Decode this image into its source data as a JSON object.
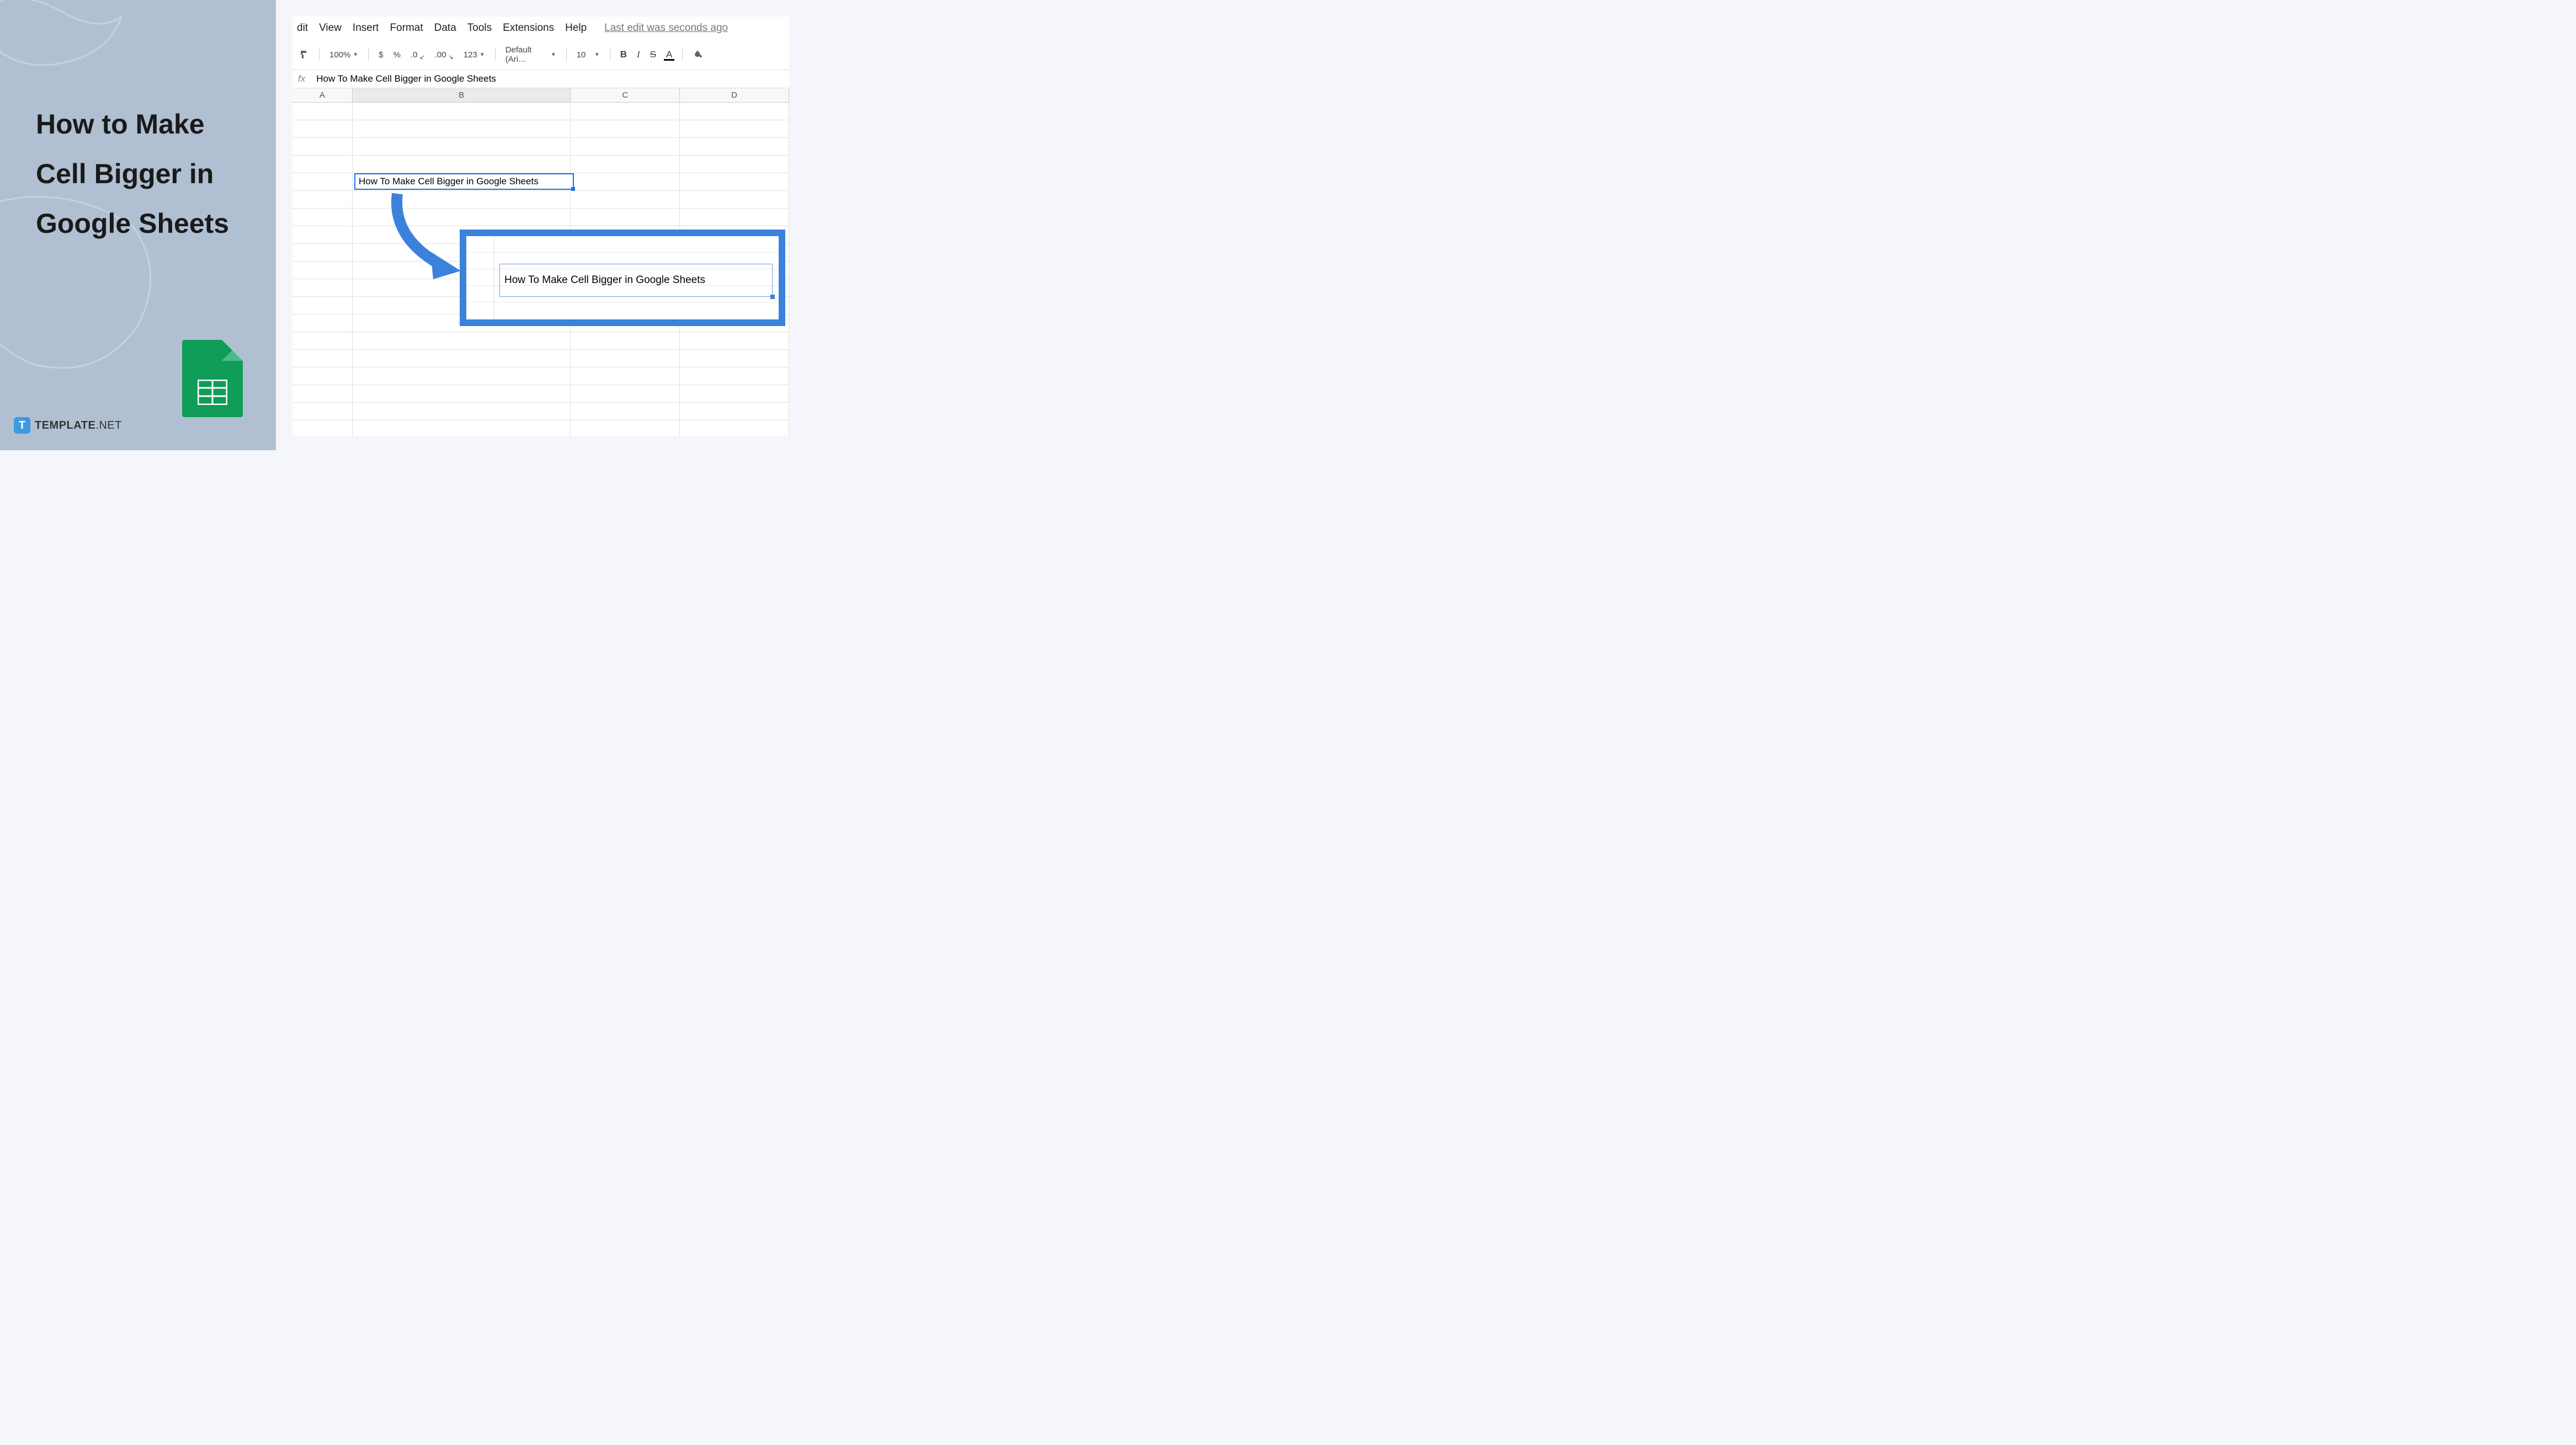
{
  "left": {
    "title": "How to Make\nCell Bigger in\nGoogle Sheets",
    "logo_t": "T",
    "logo_name": "TEMPLATE",
    "logo_tld": ".NET"
  },
  "menu": {
    "edit": "dit",
    "view": "View",
    "insert": "Insert",
    "format": "Format",
    "data": "Data",
    "tools": "Tools",
    "extensions": "Extensions",
    "help": "Help",
    "last_edit": "Last edit was seconds ago"
  },
  "toolbar": {
    "zoom": "100%",
    "currency": "$",
    "percent": "%",
    "dec_dec": ".0",
    "inc_dec": ".00",
    "more_formats": "123",
    "font": "Default (Ari…",
    "font_size": "10",
    "bold": "B",
    "italic": "I",
    "strike": "S",
    "text_color": "A"
  },
  "formula": {
    "fx": "fx",
    "value": "How To Make Cell Bigger in Google Sheets"
  },
  "columns": {
    "a": "A",
    "b": "B",
    "c": "C",
    "d": "D"
  },
  "cells": {
    "selected_text": "How To Make Cell Bigger in Google Sheets",
    "callout_text": "How To Make Cell Bigger in Google Sheets"
  }
}
